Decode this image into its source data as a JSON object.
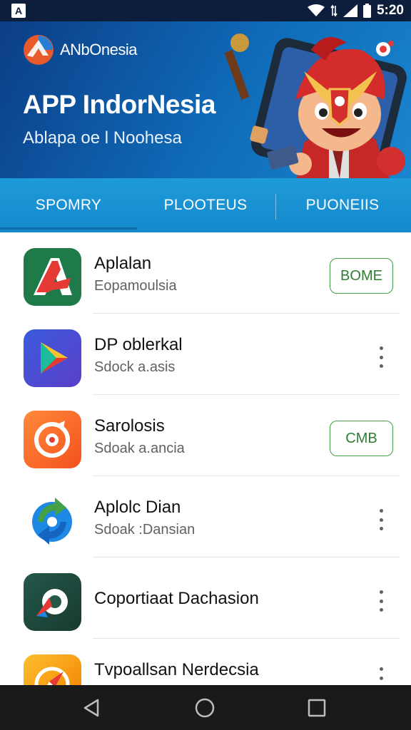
{
  "status_bar": {
    "time": "5:20",
    "left_icon": "A"
  },
  "banner": {
    "brand": "ANbOnesia",
    "title": "APP IndorNesia",
    "subtitle": "Ablapa oe l Noohesa",
    "colors": {
      "start": "#0c3d86",
      "end": "#1a86d0"
    }
  },
  "tabs": [
    {
      "label": "SPOMRY",
      "active": true
    },
    {
      "label": "PLOOTEUS",
      "active": false
    },
    {
      "label": "PUONEIIS",
      "active": false
    }
  ],
  "apps": [
    {
      "title": "Aplalan",
      "subtitle": "Eopamoulsia",
      "action": "pill",
      "action_label": "BOME",
      "icon": "red-a-logo-icon",
      "icon_bg": "#1f7a4a"
    },
    {
      "title": "DP oblerkal",
      "subtitle": "Sdock a.asis",
      "action": "menu",
      "icon": "play-triangle-icon",
      "icon_bg": "#4a3fd8"
    },
    {
      "title": "Sarolosis",
      "subtitle": "Sdoak a.ancia",
      "action": "pill",
      "action_label": "CMB",
      "icon": "orange-target-icon",
      "icon_bg": "#f26a2b"
    },
    {
      "title": "Aplolc Dian",
      "subtitle": "Sdoak :Dansian",
      "action": "menu",
      "icon": "swirl-arrow-icon",
      "icon_bg": "#ffffff"
    },
    {
      "title": "Coportiaat Dachasion",
      "subtitle": "",
      "action": "menu",
      "icon": "dark-green-arrow-icon",
      "icon_bg": "#1d4a3c"
    },
    {
      "title": "Tvpoallsan Nerdecsia",
      "subtitle": "",
      "action": "menu",
      "icon": "yellow-compass-icon",
      "icon_bg": "#f39a1e"
    }
  ],
  "navbar": {
    "buttons": [
      "back-icon",
      "home-icon",
      "recents-icon"
    ]
  }
}
